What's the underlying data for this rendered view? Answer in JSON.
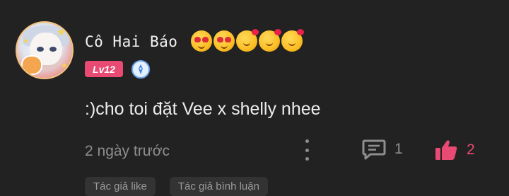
{
  "comment": {
    "username": "Cô Hai Báo",
    "username_emojis": [
      "heart-eyes-emoji",
      "heart-eyes-emoji",
      "smiling-face-with-hearts-emoji",
      "smiling-face-with-hearts-emoji",
      "smiling-face-with-hearts-emoji"
    ],
    "level_badge": "Lv12",
    "text": ":)cho toi đặt Vee x shelly nhee",
    "time": "2 ngày trước",
    "reply_count": "1",
    "like_count": "2",
    "chips": [
      "Tác giả like",
      "Tác giả bình luận"
    ]
  },
  "colors": {
    "background": "#222222",
    "level_badge": "#e84a73",
    "like_accent": "#e84a73",
    "muted_text": "#8e8e8e"
  }
}
